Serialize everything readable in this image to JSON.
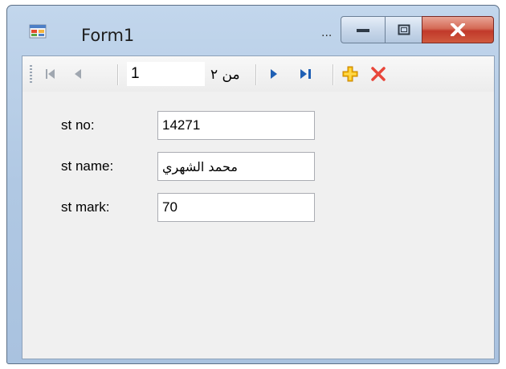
{
  "window": {
    "title": "Form1",
    "title_overflow": "...",
    "icons": {
      "app": "form-app-icon",
      "minimize": "minimize-icon",
      "maximize": "maximize-icon",
      "close": "close-icon"
    }
  },
  "navigator": {
    "icons": [
      "move-first-icon",
      "move-previous-icon",
      "move-next-icon",
      "move-last-icon",
      "add-new-icon",
      "delete-icon"
    ],
    "position": "1",
    "count_label": "من ٢"
  },
  "fields": [
    {
      "label": "st no:",
      "value": "14271"
    },
    {
      "label": "st name:",
      "value": "محمد الشهري"
    },
    {
      "label": "st mark:",
      "value": "70"
    }
  ],
  "colors": {
    "accent_blue": "#1f5fb4",
    "add_yellow": "#f0b400",
    "delete_red": "#e8463a"
  }
}
